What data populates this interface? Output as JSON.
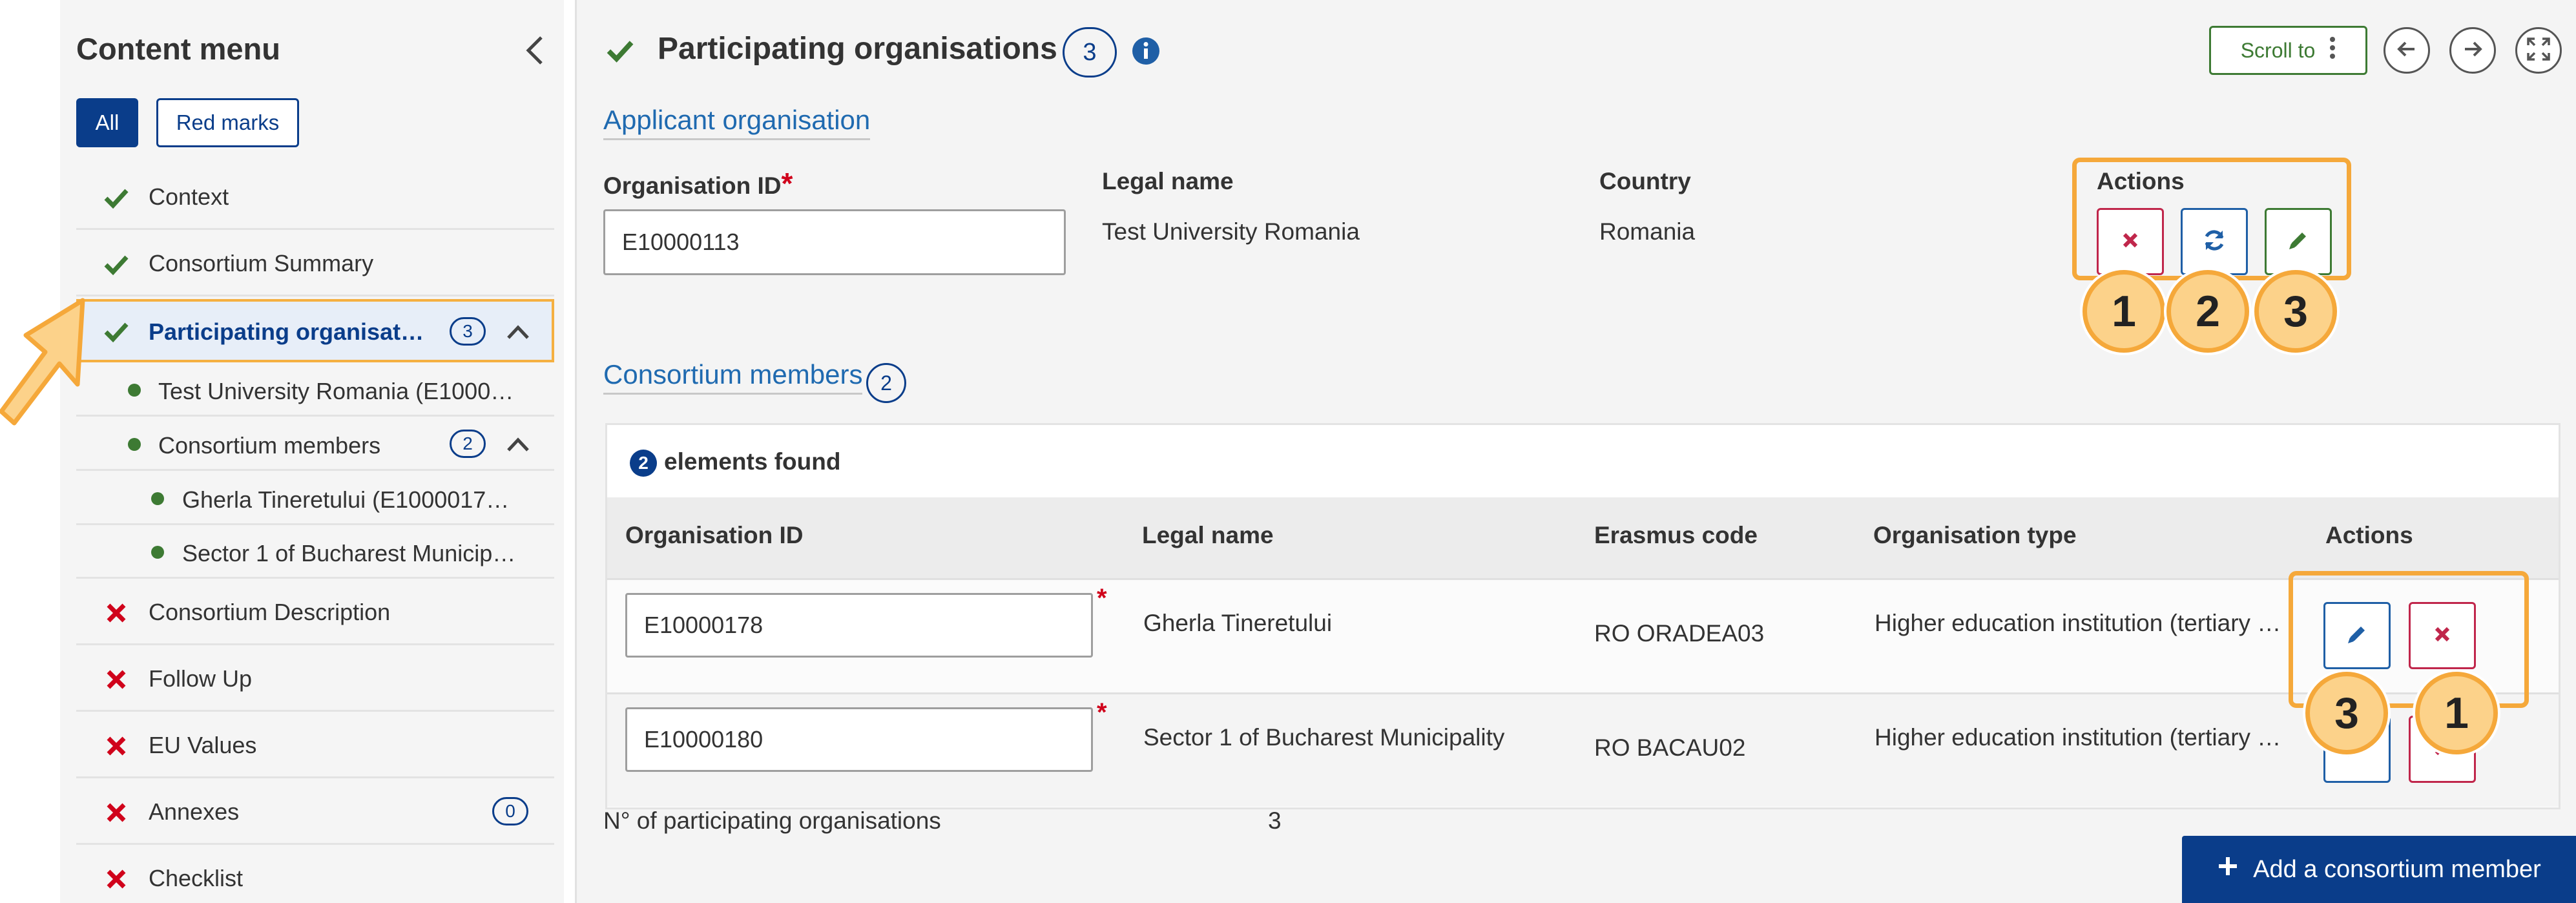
{
  "sidebar": {
    "title": "Content menu",
    "filters": {
      "all": "All",
      "red_marks": "Red marks"
    },
    "items": [
      {
        "label": "Context",
        "status": "done"
      },
      {
        "label": "Consortium Summary",
        "status": "done"
      },
      {
        "label": "Participating organisat…",
        "status": "done",
        "count": "3",
        "active": true
      },
      {
        "label": "Consortium Description",
        "status": "error"
      },
      {
        "label": "Follow Up",
        "status": "error"
      },
      {
        "label": "EU Values",
        "status": "error"
      },
      {
        "label": "Annexes",
        "status": "error",
        "count": "0"
      },
      {
        "label": "Checklist",
        "status": "error"
      }
    ],
    "sub_items": [
      {
        "label": "Test University Romania (E1000…"
      },
      {
        "label": "Consortium members",
        "count": "2"
      },
      {
        "label": "Gherla Tineretului (E1000017…"
      },
      {
        "label": "Sector 1 of Bucharest Municip…"
      }
    ]
  },
  "header": {
    "title": "Participating organisations",
    "count": "3",
    "scroll_to": "Scroll to"
  },
  "applicant": {
    "section_title": "Applicant organisation",
    "org_id_label": "Organisation ID",
    "org_id_value": "E10000113",
    "legal_name_label": "Legal name",
    "legal_name_value": "Test University Romania",
    "country_label": "Country",
    "country_value": "Romania",
    "actions_label": "Actions"
  },
  "consortium": {
    "section_title": "Consortium members",
    "count": "2",
    "found_count": "2",
    "found_text": "elements found",
    "columns": [
      "Organisation ID",
      "Legal name",
      "Erasmus code",
      "Organisation type",
      "Actions"
    ],
    "rows": [
      {
        "org_id": "E10000178",
        "legal_name": "Gherla Tineretului",
        "erasmus_code": "RO ORADEA03",
        "org_type": "Higher education institution (tertiary …"
      },
      {
        "org_id": "E10000180",
        "legal_name": "Sector 1 of Bucharest Municipality",
        "erasmus_code": "RO BACAU02",
        "org_type": "Higher education institution (tertiary …"
      }
    ],
    "participating_label": "N° of participating organisations",
    "participating_value": "3",
    "add_button": "Add a consortium member"
  },
  "callouts": {
    "top": [
      "1",
      "2",
      "3"
    ],
    "table": [
      "3",
      "1"
    ]
  },
  "colors": {
    "primary": "#0a3d8a",
    "success": "#3d7a33",
    "danger": "#c0264b",
    "highlight": "#f5a83a"
  }
}
